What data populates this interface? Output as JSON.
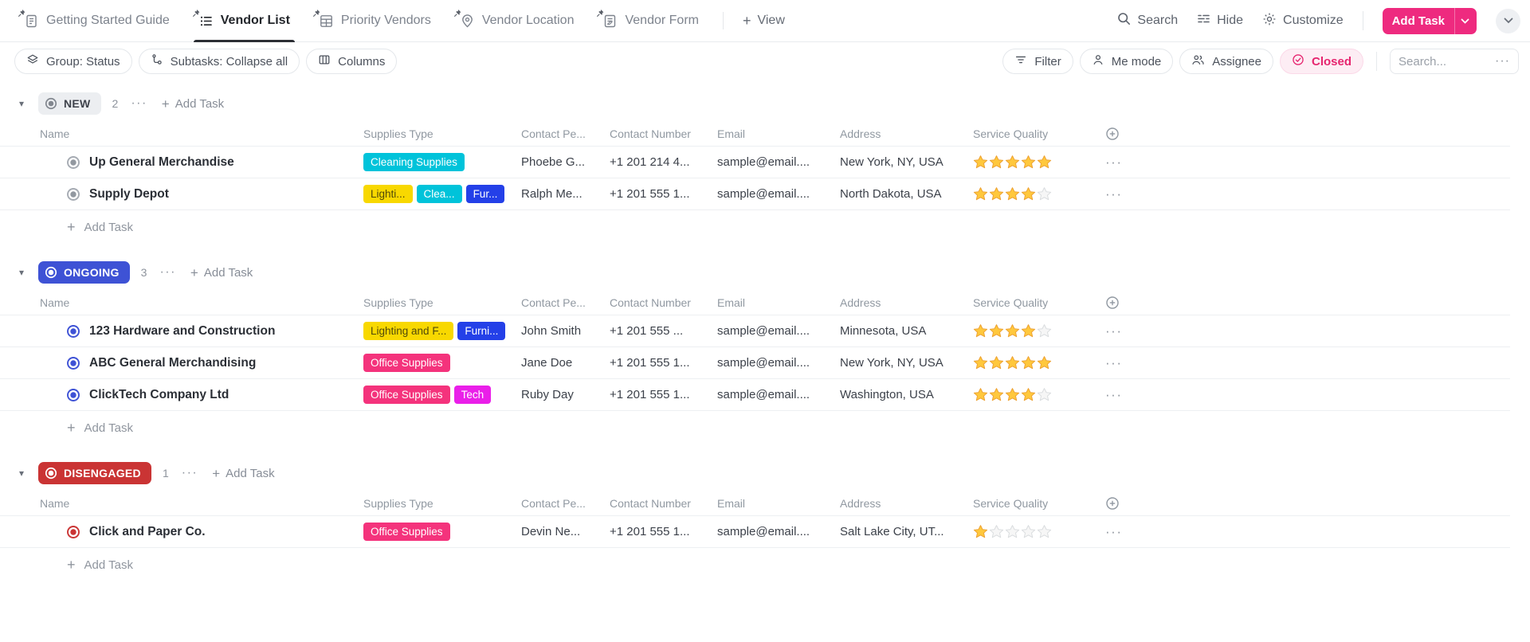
{
  "topbar": {
    "tabs": [
      {
        "label": "Getting Started Guide",
        "icon": "doc-icon",
        "active": false
      },
      {
        "label": "Vendor List",
        "icon": "list-icon",
        "active": true
      },
      {
        "label": "Priority Vendors",
        "icon": "table-icon",
        "active": false
      },
      {
        "label": "Vendor Location",
        "icon": "location-icon",
        "active": false
      },
      {
        "label": "Vendor Form",
        "icon": "form-icon",
        "active": false
      }
    ],
    "view_label": "View",
    "search_label": "Search",
    "hide_label": "Hide",
    "customize_label": "Customize",
    "add_task": {
      "label": "Add Task",
      "color": "#ee2a7f"
    }
  },
  "toolbar": {
    "group": "Group: Status",
    "subtasks": "Subtasks: Collapse all",
    "columns": "Columns",
    "filter": "Filter",
    "me_mode": "Me mode",
    "assignee": "Assignee",
    "closed": "Closed",
    "search_placeholder": "Search...",
    "more": "···"
  },
  "table": {
    "headers": [
      "Name",
      "Supplies Type",
      "Contact Pe...",
      "Contact Number",
      "Email",
      "Address",
      "Service Quality"
    ],
    "add_task_label": "Add Task",
    "max_rating": 5
  },
  "groups": [
    {
      "status": "NEW",
      "count": "2",
      "badge_bg": "#eceef1",
      "badge_fg": "#3f434c",
      "badge_ring": "#82878f",
      "row_ring": "#a6abb3",
      "row_dot": "#9298a0",
      "rows": [
        {
          "name": "Up General Merchandise",
          "tags": [
            {
              "label": "Cleaning Supplies",
              "bg": "#00c3da",
              "fg": "#ffffff"
            }
          ],
          "contact_person": "Phoebe G...",
          "contact_number": "+1 201 214 4...",
          "email": "sample@email....",
          "address": "New York, NY, USA",
          "rating": 5
        },
        {
          "name": "Supply Depot",
          "tags": [
            {
              "label": "Lighti...",
              "bg": "#f8d800",
              "fg": "#514a0a"
            },
            {
              "label": "Clea...",
              "bg": "#00c3da",
              "fg": "#ffffff"
            },
            {
              "label": "Fur...",
              "bg": "#2440e8",
              "fg": "#ffffff"
            }
          ],
          "contact_person": "Ralph Me...",
          "contact_number": "+1 201 555 1...",
          "email": "sample@email....",
          "address": "North Dakota, USA",
          "rating": 4
        }
      ]
    },
    {
      "status": "ONGOING",
      "count": "3",
      "badge_bg": "#3e52d5",
      "badge_fg": "#ffffff",
      "badge_ring": "#ffffff",
      "row_ring": "#3e52d5",
      "row_dot": "#3e52d5",
      "rows": [
        {
          "name": "123 Hardware and Construction",
          "tags": [
            {
              "label": "Lighting and F...",
              "bg": "#f8d800",
              "fg": "#514a0a"
            },
            {
              "label": "Furni...",
              "bg": "#2440e8",
              "fg": "#ffffff"
            }
          ],
          "contact_person": "John Smith",
          "contact_number": "+1 201 555 ...",
          "email": "sample@email....",
          "address": "Minnesota, USA",
          "rating": 4
        },
        {
          "name": "ABC General Merchandising",
          "tags": [
            {
              "label": "Office Supplies",
              "bg": "#f4337c",
              "fg": "#ffffff"
            }
          ],
          "contact_person": "Jane Doe",
          "contact_number": "+1 201 555 1...",
          "email": "sample@email....",
          "address": "New York, NY, USA",
          "rating": 5
        },
        {
          "name": "ClickTech Company Ltd",
          "tags": [
            {
              "label": "Office Supplies",
              "bg": "#f4337c",
              "fg": "#ffffff"
            },
            {
              "label": "Tech",
              "bg": "#ea1fe9",
              "fg": "#ffffff"
            }
          ],
          "contact_person": "Ruby Day",
          "contact_number": "+1 201 555 1...",
          "email": "sample@email....",
          "address": "Washington, USA",
          "rating": 4
        }
      ]
    },
    {
      "status": "DISENGAGED",
      "count": "1",
      "badge_bg": "#ca3434",
      "badge_fg": "#ffffff",
      "badge_ring": "#ffffff",
      "row_ring": "#ca3434",
      "row_dot": "#ca3434",
      "rows": [
        {
          "name": "Click and Paper Co.",
          "tags": [
            {
              "label": "Office Supplies",
              "bg": "#f4337c",
              "fg": "#ffffff"
            }
          ],
          "contact_person": "Devin Ne...",
          "contact_number": "+1 201 555 1...",
          "email": "sample@email....",
          "address": "Salt Lake City, UT...",
          "rating": 1
        }
      ]
    }
  ],
  "colors": {
    "star_filled": "#ffc83d",
    "star_filled_stroke": "#eda132",
    "star_empty": "#f6f6f6",
    "star_empty_stroke": "#d9dcde",
    "accent_pink": "#ee2a7f"
  }
}
